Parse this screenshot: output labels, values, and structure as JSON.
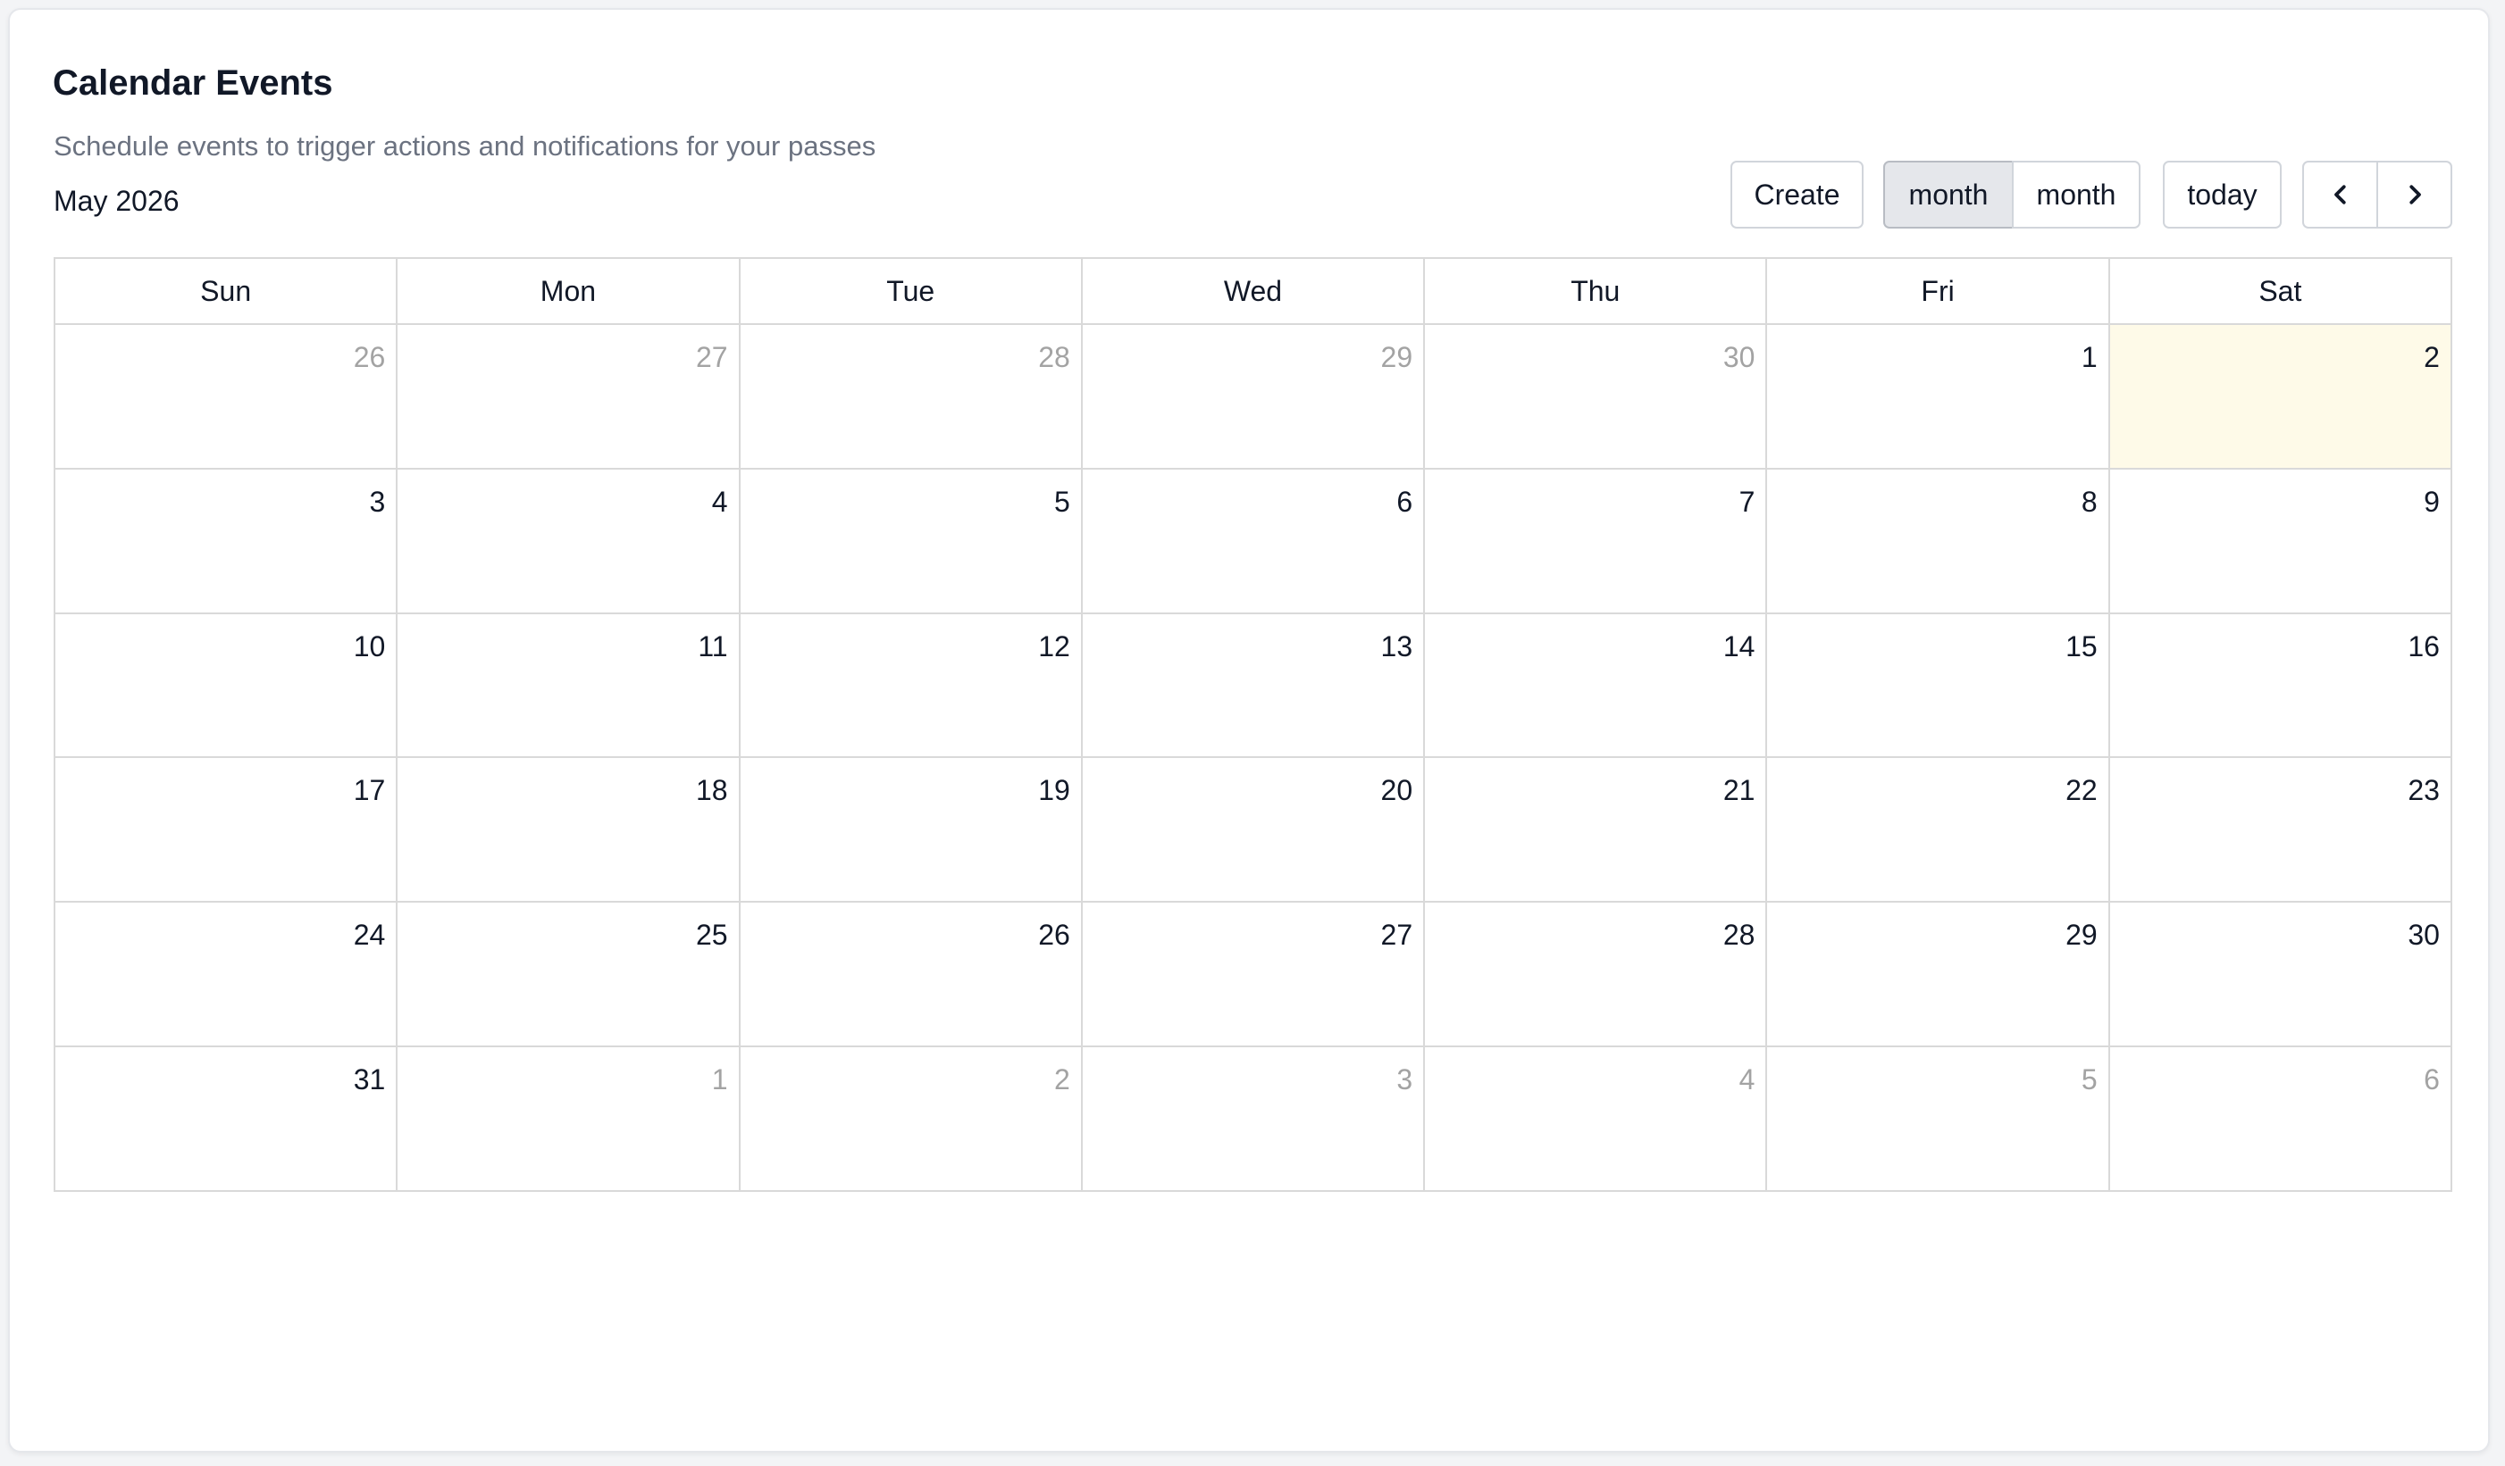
{
  "header": {
    "title": "Calendar Events",
    "subtitle": "Schedule events to trigger actions and notifications for your passes",
    "current_month": "May 2026"
  },
  "toolbar": {
    "create_label": "Create",
    "view_options": [
      "month",
      "month"
    ],
    "active_view_index": 0,
    "today_label": "today",
    "prev_icon": "chevron-left-icon",
    "next_icon": "chevron-right-icon"
  },
  "calendar": {
    "weekdays": [
      "Sun",
      "Mon",
      "Tue",
      "Wed",
      "Thu",
      "Fri",
      "Sat"
    ],
    "weeks": [
      [
        {
          "day": "26",
          "other": true
        },
        {
          "day": "27",
          "other": true
        },
        {
          "day": "28",
          "other": true
        },
        {
          "day": "29",
          "other": true
        },
        {
          "day": "30",
          "other": true
        },
        {
          "day": "1",
          "other": false
        },
        {
          "day": "2",
          "other": false,
          "today": true
        }
      ],
      [
        {
          "day": "3",
          "other": false
        },
        {
          "day": "4",
          "other": false
        },
        {
          "day": "5",
          "other": false
        },
        {
          "day": "6",
          "other": false
        },
        {
          "day": "7",
          "other": false
        },
        {
          "day": "8",
          "other": false
        },
        {
          "day": "9",
          "other": false
        }
      ],
      [
        {
          "day": "10",
          "other": false
        },
        {
          "day": "11",
          "other": false
        },
        {
          "day": "12",
          "other": false
        },
        {
          "day": "13",
          "other": false
        },
        {
          "day": "14",
          "other": false
        },
        {
          "day": "15",
          "other": false
        },
        {
          "day": "16",
          "other": false
        }
      ],
      [
        {
          "day": "17",
          "other": false
        },
        {
          "day": "18",
          "other": false
        },
        {
          "day": "19",
          "other": false
        },
        {
          "day": "20",
          "other": false
        },
        {
          "day": "21",
          "other": false
        },
        {
          "day": "22",
          "other": false
        },
        {
          "day": "23",
          "other": false
        }
      ],
      [
        {
          "day": "24",
          "other": false
        },
        {
          "day": "25",
          "other": false
        },
        {
          "day": "26",
          "other": false
        },
        {
          "day": "27",
          "other": false
        },
        {
          "day": "28",
          "other": false
        },
        {
          "day": "29",
          "other": false
        },
        {
          "day": "30",
          "other": false
        }
      ],
      [
        {
          "day": "31",
          "other": false
        },
        {
          "day": "1",
          "other": true
        },
        {
          "day": "2",
          "other": true
        },
        {
          "day": "3",
          "other": true
        },
        {
          "day": "4",
          "other": true
        },
        {
          "day": "5",
          "other": true
        },
        {
          "day": "6",
          "other": true
        }
      ]
    ]
  },
  "colors": {
    "today_highlight": "#fefae8",
    "other_month_text": "#a3a3a3",
    "active_view_bg": "#e5e7eb",
    "grid_border": "#d9d9d9"
  }
}
